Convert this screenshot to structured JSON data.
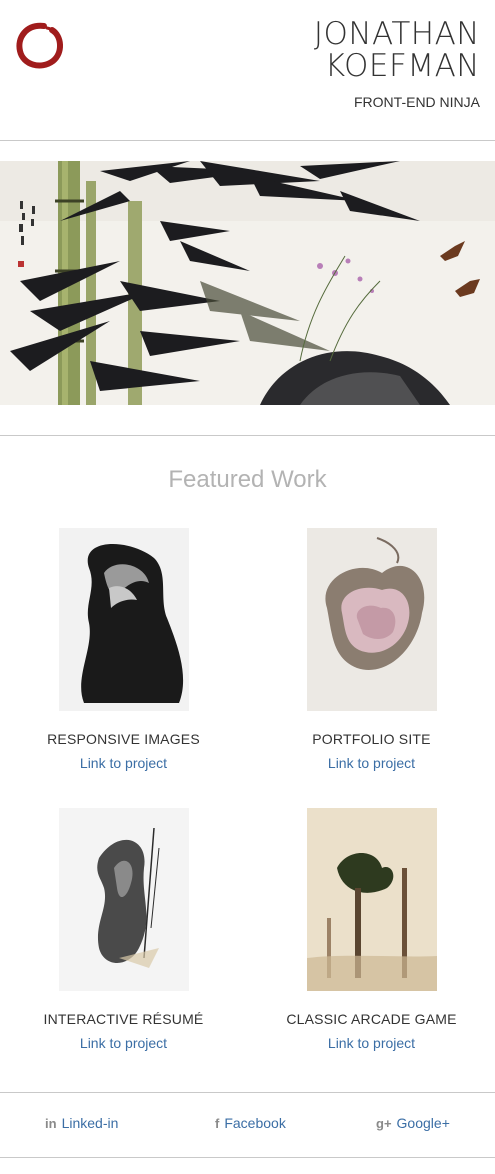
{
  "header": {
    "name_line1": "JONATHAN",
    "name_line2": "KOEFMAN",
    "tagline": "FRONT-END NINJA"
  },
  "featured": {
    "title": "Featured Work",
    "projects": [
      {
        "title": "RESPONSIVE IMAGES",
        "link": "Link to project"
      },
      {
        "title": "PORTFOLIO SITE",
        "link": "Link to project"
      },
      {
        "title": "INTERACTIVE RÉSUMÉ",
        "link": "Link to project"
      },
      {
        "title": "CLASSIC ARCADE GAME",
        "link": "Link to project"
      }
    ]
  },
  "footer": {
    "links": [
      {
        "label": "Linked-in",
        "icon": "linkedin-icon",
        "glyph": "in"
      },
      {
        "label": "Facebook",
        "icon": "facebook-icon",
        "glyph": "f"
      },
      {
        "label": "Google+",
        "icon": "google-plus-icon",
        "glyph": "g+"
      }
    ]
  },
  "colors": {
    "accent_link": "#3b6ea5",
    "logo_red": "#a01c1c",
    "section_title": "#b3b3b3"
  }
}
